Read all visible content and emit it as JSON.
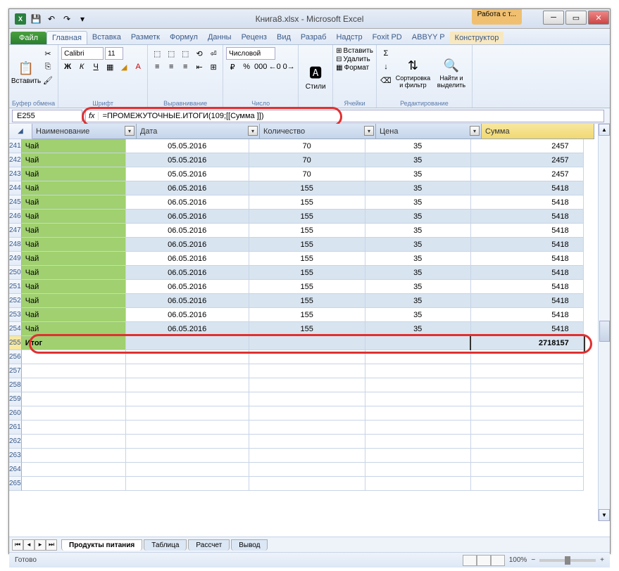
{
  "title": "Книга8.xlsx - Microsoft Excel",
  "table_tools": "Работа с т...",
  "tabs": {
    "file": "Файл",
    "list": [
      "Главная",
      "Вставка",
      "Разметк",
      "Формул",
      "Данны",
      "Реценз",
      "Вид",
      "Разраб",
      "Надстр",
      "Foxit PD",
      "ABBYY P"
    ],
    "ctx": "Конструктор",
    "active": 0
  },
  "ribbon": {
    "clipboard": {
      "label": "Буфер обмена",
      "paste": "Вставить"
    },
    "font": {
      "label": "Шрифт",
      "name": "Calibri",
      "size": "11"
    },
    "align": {
      "label": "Выравнивание"
    },
    "number": {
      "label": "Число",
      "format": "Числовой"
    },
    "styles": {
      "label": "",
      "btn": "Стили"
    },
    "cells": {
      "label": "Ячейки",
      "insert": "Вставить",
      "delete": "Удалить",
      "format": "Формат"
    },
    "editing": {
      "label": "Редактирование",
      "sort": "Сортировка и фильтр",
      "find": "Найти и выделить"
    }
  },
  "name_box": "E255",
  "formula": "=ПРОМЕЖУТОЧНЫЕ.ИТОГИ(109;[[Сумма ]])",
  "headers": [
    "Наименование",
    "Дата",
    "Количество",
    "Цена",
    "Сумма"
  ],
  "rows": [
    {
      "n": 241,
      "name": "Чай",
      "date": "05.05.2016",
      "qty": "70",
      "price": "35",
      "sum": "2457"
    },
    {
      "n": 242,
      "name": "Чай",
      "date": "05.05.2016",
      "qty": "70",
      "price": "35",
      "sum": "2457"
    },
    {
      "n": 243,
      "name": "Чай",
      "date": "05.05.2016",
      "qty": "70",
      "price": "35",
      "sum": "2457"
    },
    {
      "n": 244,
      "name": "Чай",
      "date": "06.05.2016",
      "qty": "155",
      "price": "35",
      "sum": "5418"
    },
    {
      "n": 245,
      "name": "Чай",
      "date": "06.05.2016",
      "qty": "155",
      "price": "35",
      "sum": "5418"
    },
    {
      "n": 246,
      "name": "Чай",
      "date": "06.05.2016",
      "qty": "155",
      "price": "35",
      "sum": "5418"
    },
    {
      "n": 247,
      "name": "Чай",
      "date": "06.05.2016",
      "qty": "155",
      "price": "35",
      "sum": "5418"
    },
    {
      "n": 248,
      "name": "Чай",
      "date": "06.05.2016",
      "qty": "155",
      "price": "35",
      "sum": "5418"
    },
    {
      "n": 249,
      "name": "Чай",
      "date": "06.05.2016",
      "qty": "155",
      "price": "35",
      "sum": "5418"
    },
    {
      "n": 250,
      "name": "Чай",
      "date": "06.05.2016",
      "qty": "155",
      "price": "35",
      "sum": "5418"
    },
    {
      "n": 251,
      "name": "Чай",
      "date": "06.05.2016",
      "qty": "155",
      "price": "35",
      "sum": "5418"
    },
    {
      "n": 252,
      "name": "Чай",
      "date": "06.05.2016",
      "qty": "155",
      "price": "35",
      "sum": "5418"
    },
    {
      "n": 253,
      "name": "Чай",
      "date": "06.05.2016",
      "qty": "155",
      "price": "35",
      "sum": "5418"
    },
    {
      "n": 254,
      "name": "Чай",
      "date": "06.05.2016",
      "qty": "155",
      "price": "35",
      "sum": "5418"
    }
  ],
  "total_row": {
    "n": 255,
    "label": "Итог",
    "sum": "2718157"
  },
  "empty_rows": [
    256,
    257,
    258,
    259,
    260,
    261,
    262,
    263,
    264,
    265
  ],
  "sheet_tabs": [
    "Продукты питания",
    "Таблица",
    "Рассчет",
    "Вывод"
  ],
  "status": {
    "ready": "Готово",
    "zoom": "100%"
  }
}
